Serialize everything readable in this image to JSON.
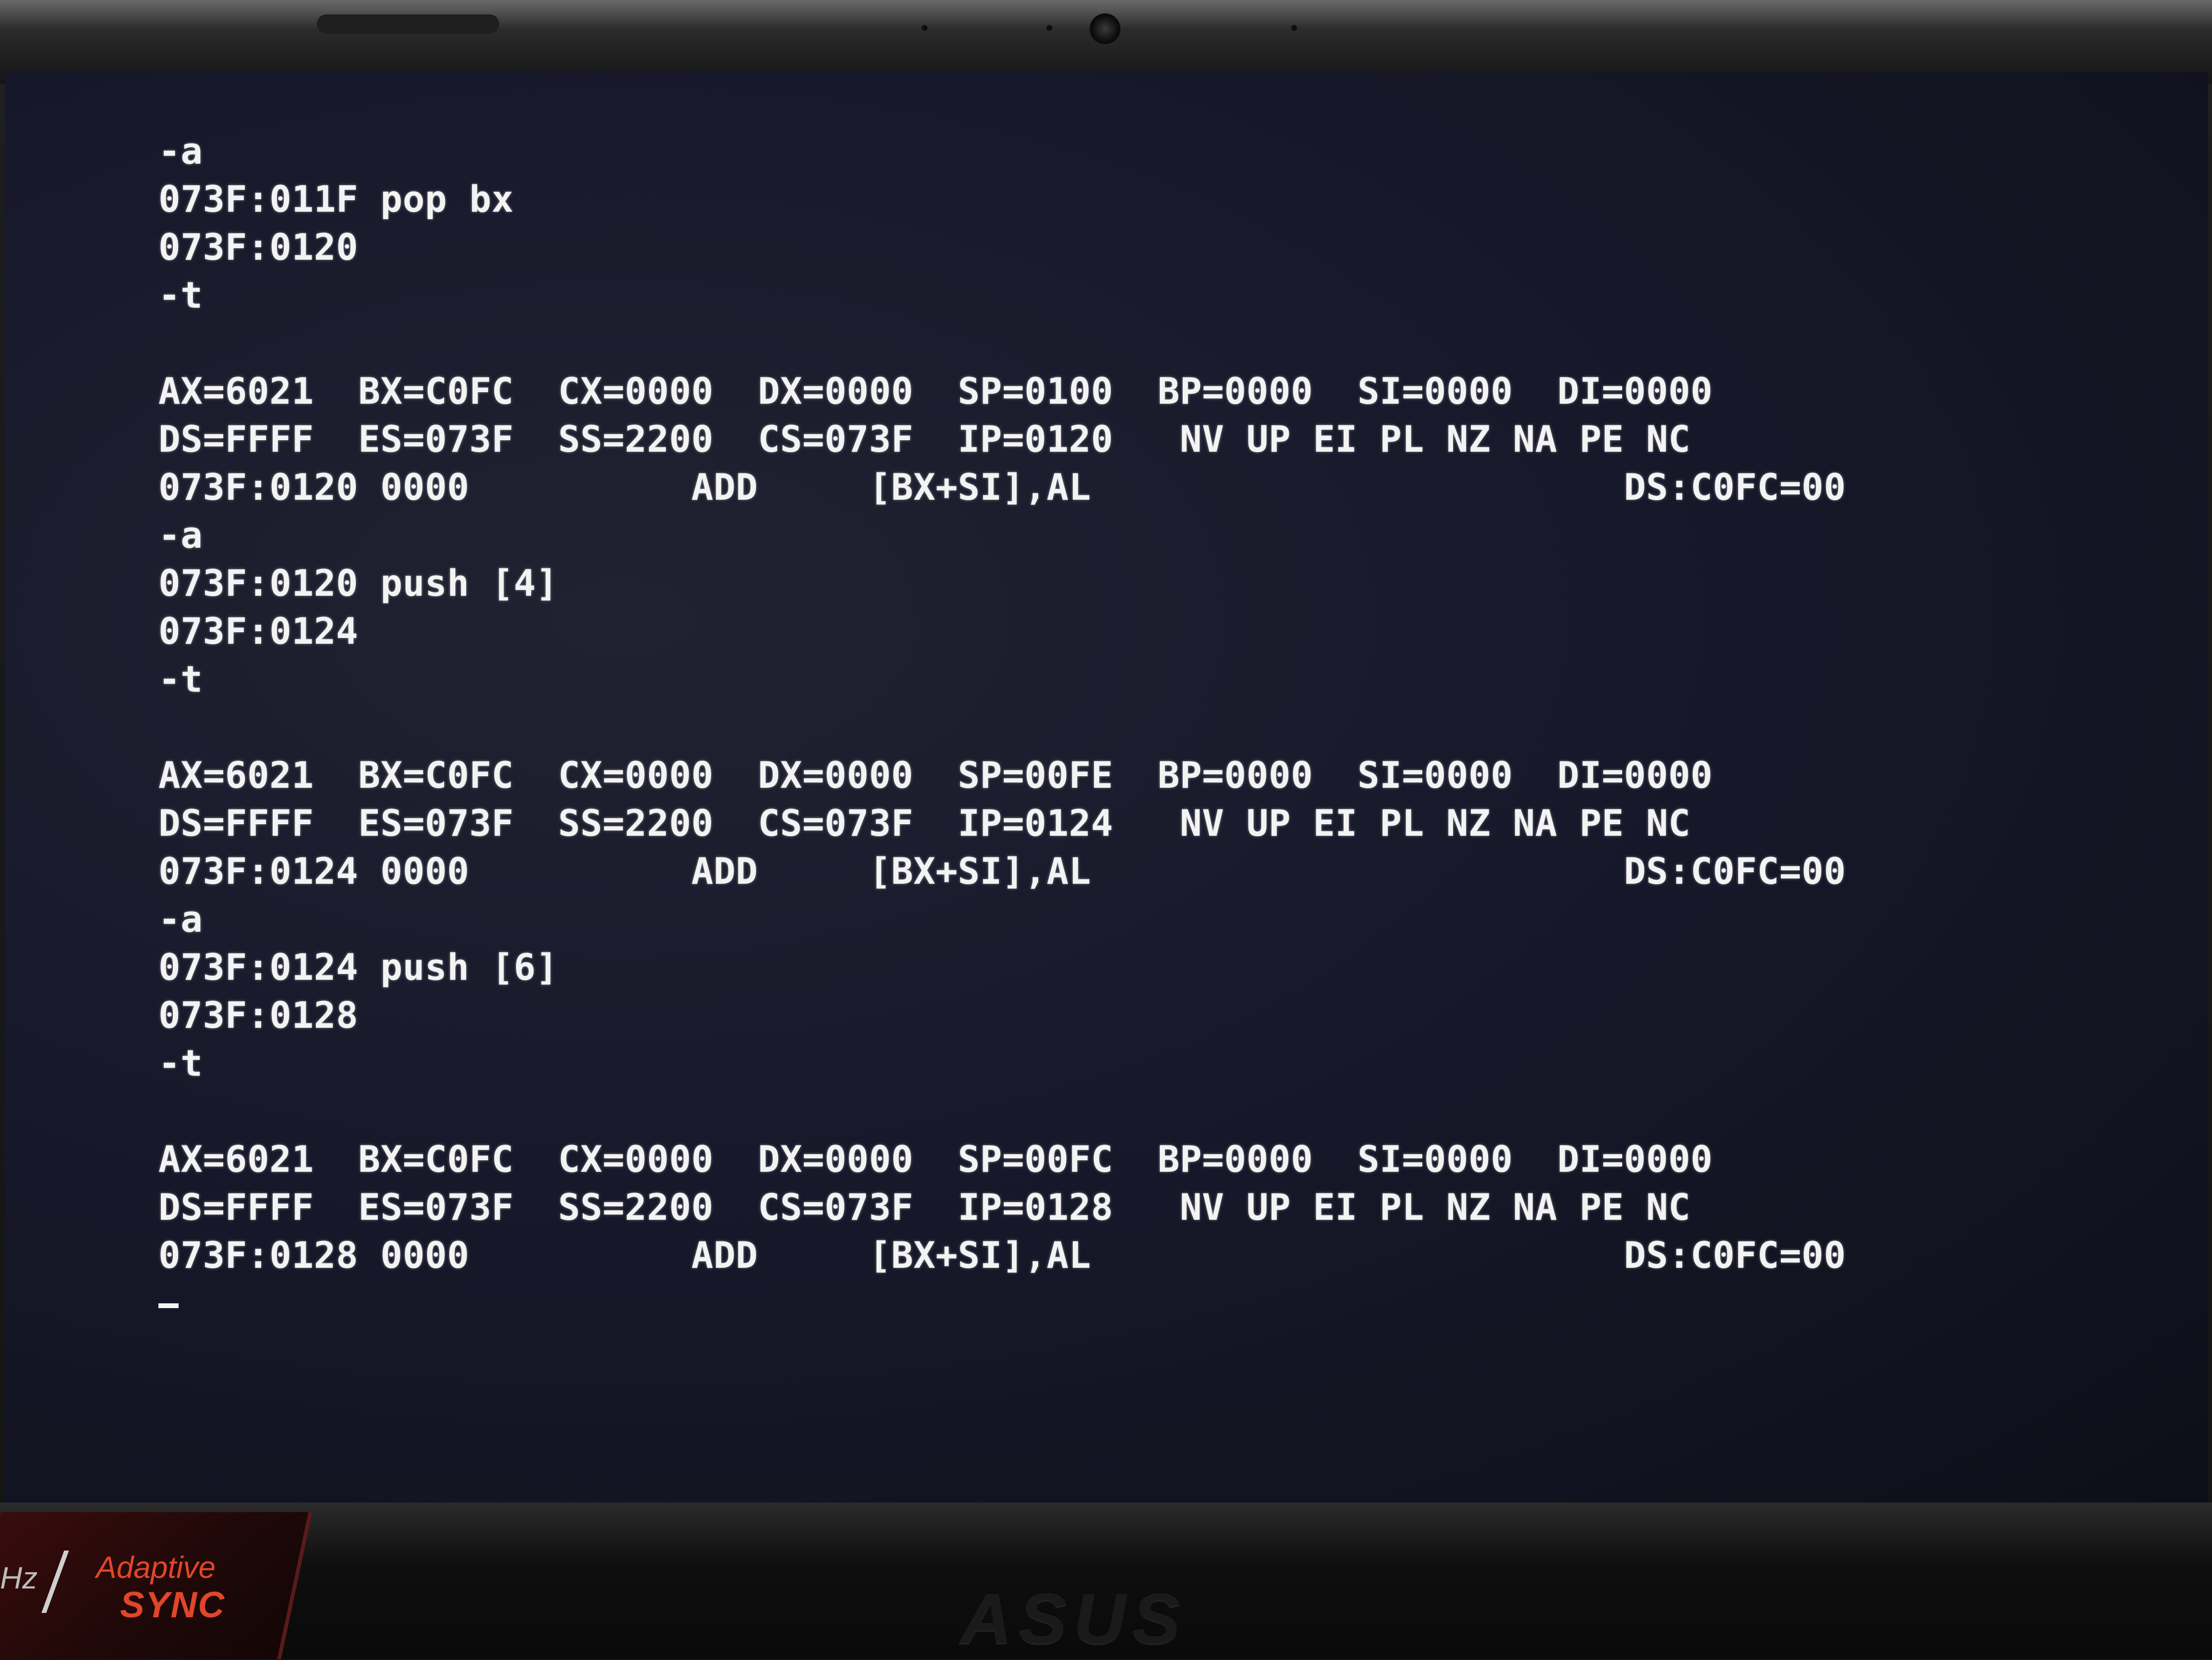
{
  "terminal": {
    "lines": [
      "-a",
      "073F:011F pop bx",
      "073F:0120",
      "-t",
      "",
      "AX=6021  BX=C0FC  CX=0000  DX=0000  SP=0100  BP=0000  SI=0000  DI=0000",
      "DS=FFFF  ES=073F  SS=2200  CS=073F  IP=0120   NV UP EI PL NZ NA PE NC",
      "073F:0120 0000          ADD     [BX+SI],AL                        DS:C0FC=00",
      "-a",
      "073F:0120 push [4]",
      "073F:0124",
      "-t",
      "",
      "AX=6021  BX=C0FC  CX=0000  DX=0000  SP=00FE  BP=0000  SI=0000  DI=0000",
      "DS=FFFF  ES=073F  SS=2200  CS=073F  IP=0124   NV UP EI PL NZ NA PE NC",
      "073F:0124 0000          ADD     [BX+SI],AL                        DS:C0FC=00",
      "-a",
      "073F:0124 push [6]",
      "073F:0128",
      "-t",
      "",
      "AX=6021  BX=C0FC  CX=0000  DX=0000  SP=00FC  BP=0000  SI=0000  DI=0000",
      "DS=FFFF  ES=073F  SS=2200  CS=073F  IP=0128   NV UP EI PL NZ NA PE NC",
      "073F:0128 0000          ADD     [BX+SI],AL                        DS:C0FC=00"
    ],
    "text_color": "#f3f3f3",
    "background_color": "#17182a",
    "cursor_icon": "underscore-cursor"
  },
  "bezel": {
    "sticker_hz": "Hz",
    "sticker_line1": "Adaptive",
    "sticker_line2": "SYNC",
    "brand_logo": "ASUS",
    "sticker_color": "#e0462a"
  }
}
